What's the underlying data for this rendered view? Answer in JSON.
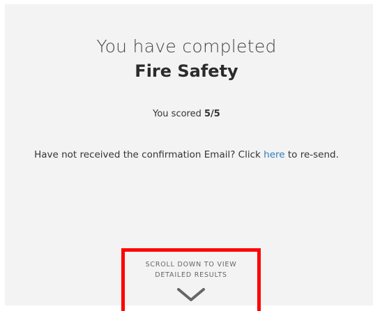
{
  "heading": {
    "completed_text": "You have completed",
    "course_title": "Fire Safety"
  },
  "score": {
    "prefix": "You scored",
    "value": "5/5"
  },
  "email_notice": {
    "before_link": "Have not received the confirmation Email? Click",
    "link_text": "here",
    "after_link": "to re-send."
  },
  "scroll_hint": {
    "line1": "SCROLL DOWN TO VIEW",
    "line2": "DETAILED RESULTS",
    "icon": "chevron-down-icon"
  },
  "colors": {
    "link": "#2f7ab9",
    "highlight": "#ff0000",
    "panel_background": "#f3f3f3"
  }
}
